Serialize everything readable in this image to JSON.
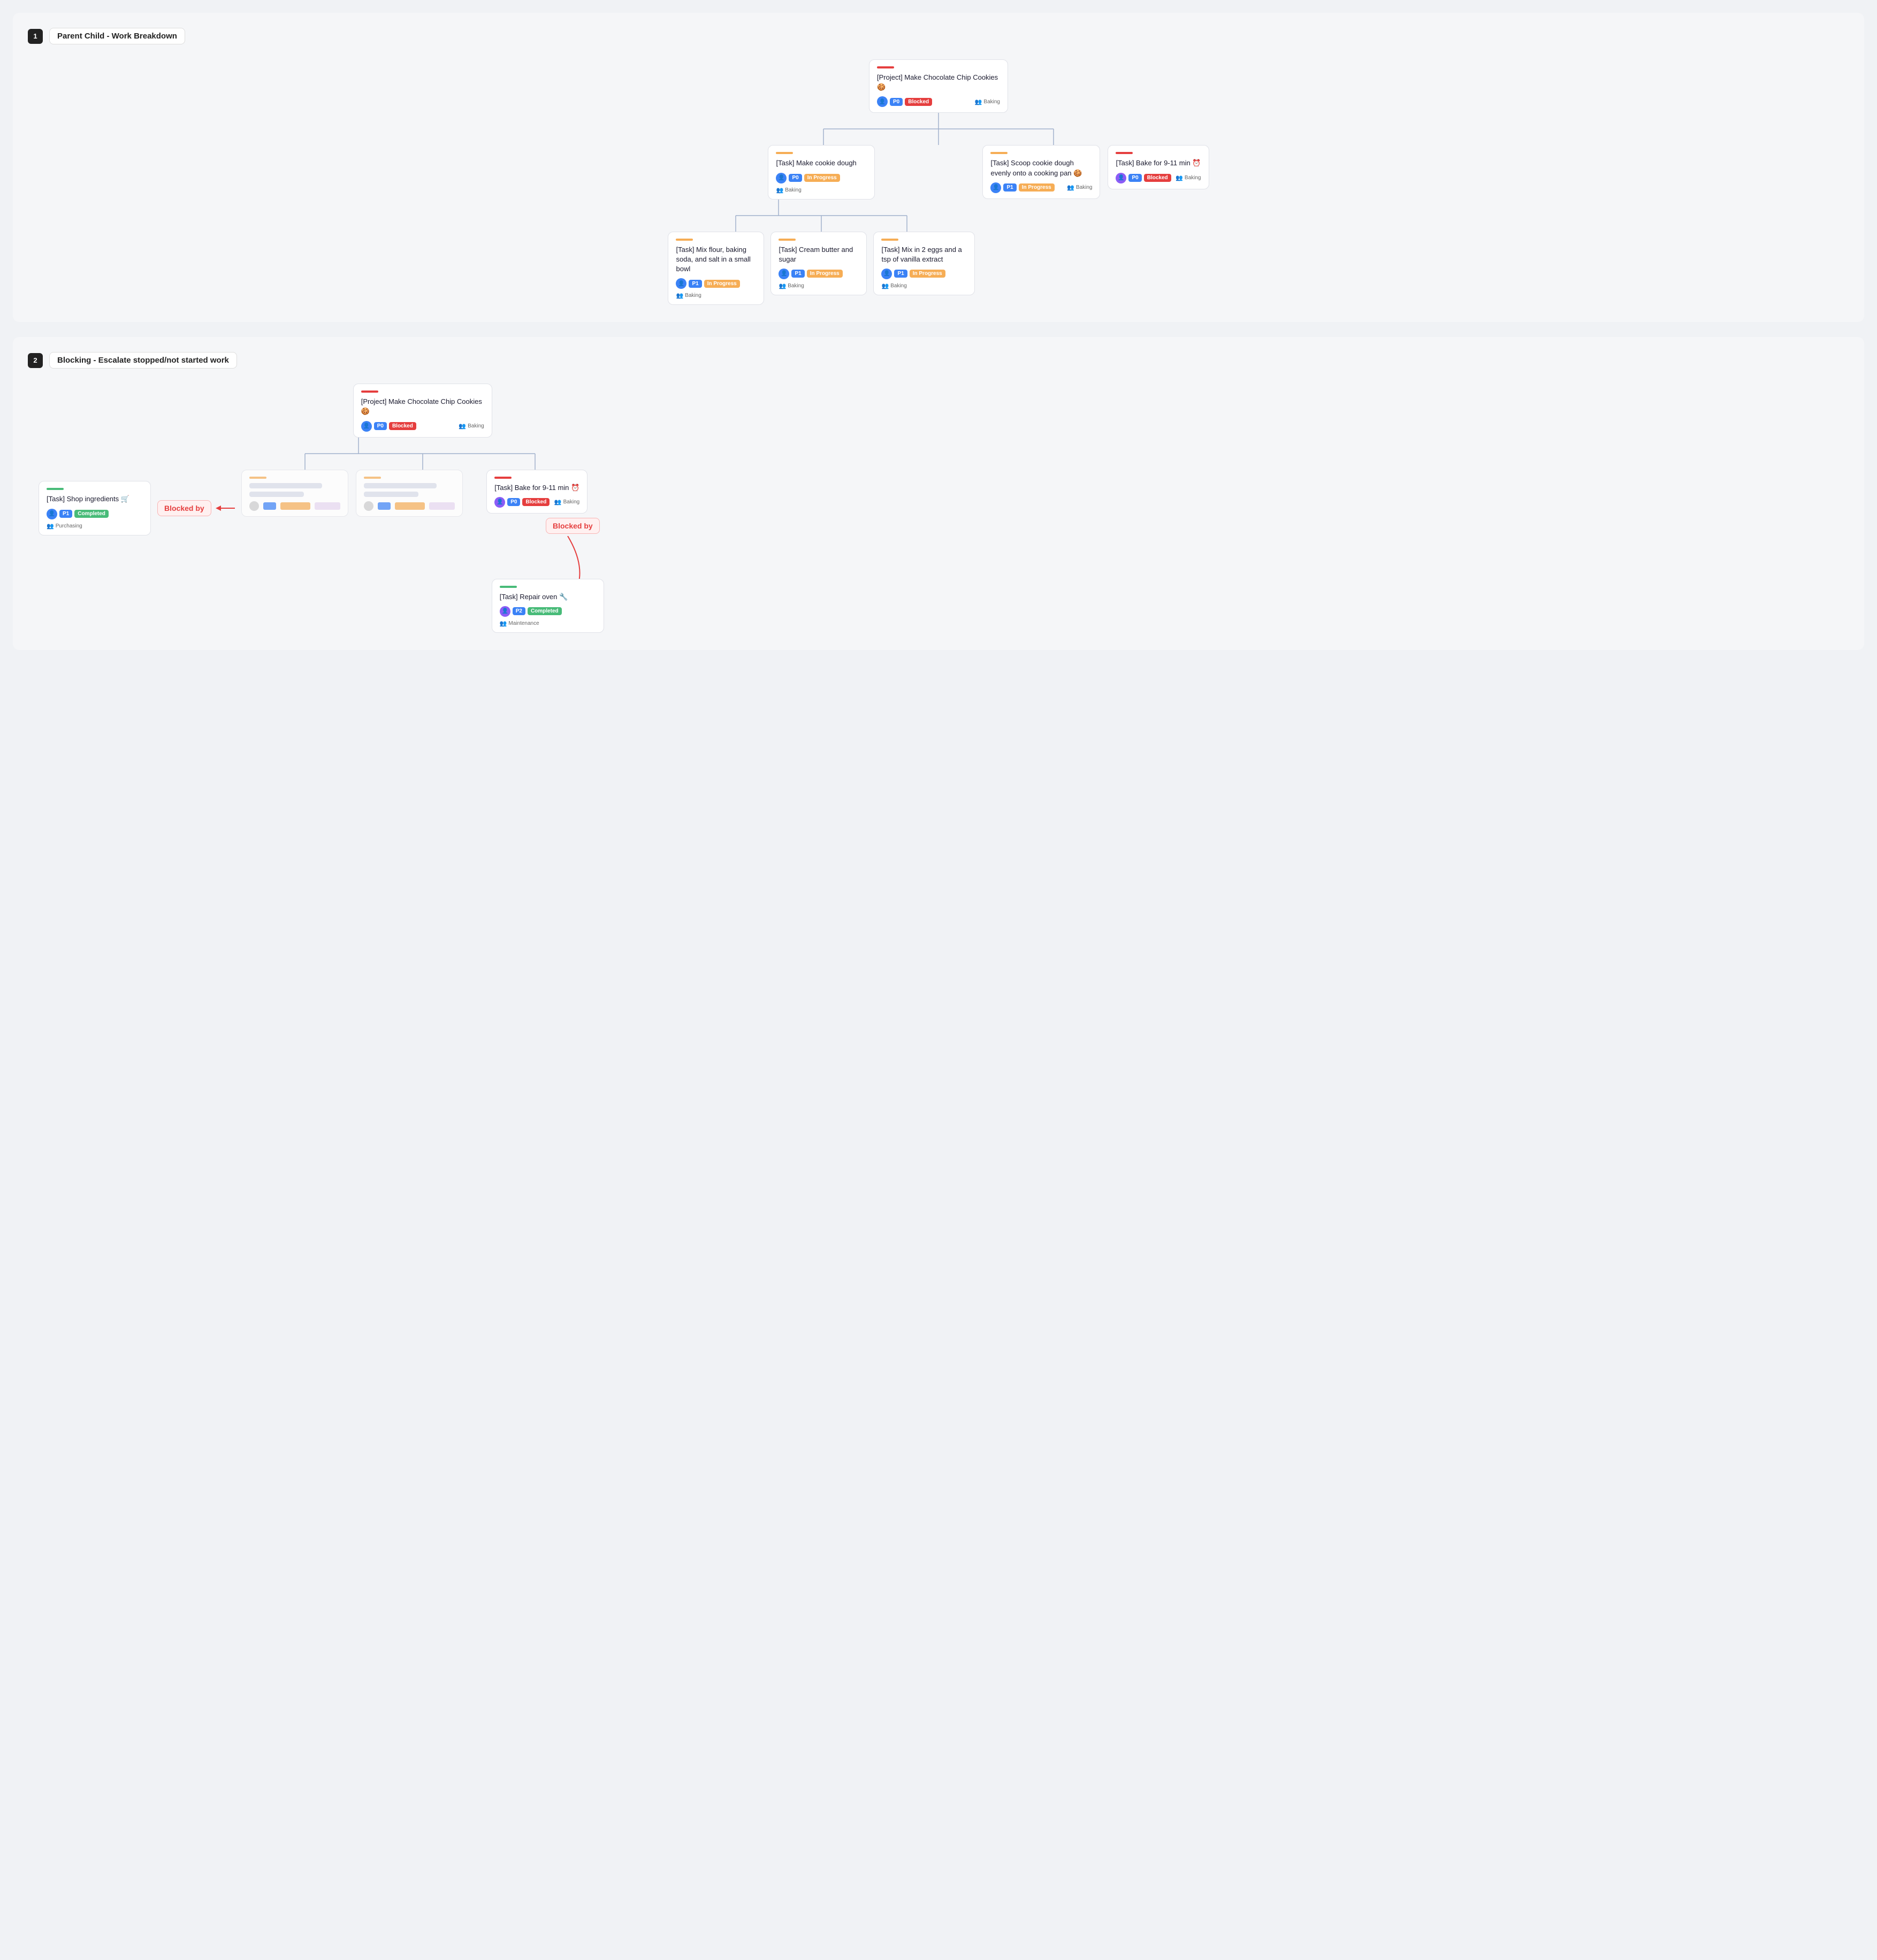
{
  "section1": {
    "number": "1",
    "title": "Parent Child - Work Breakdown",
    "root": {
      "accent": "accent-red",
      "icon": "📄",
      "title": "[Project] Make Chocolate Chip Cookies 🍪",
      "avatar_color": "avatar-blue",
      "priority": "P0",
      "status": "Blocked",
      "status_class": "badge-blocked",
      "team": "Baking"
    },
    "level2": [
      {
        "accent": "accent-orange",
        "title": "[Task] Make cookie dough",
        "avatar_color": "avatar-blue",
        "priority": "P0",
        "status": "In Progress",
        "status_class": "badge-inprogress",
        "team": "Baking"
      },
      {
        "accent": "accent-orange",
        "title": "[Task] Scoop cookie dough evenly onto a cooking pan 🍪",
        "avatar_color": "avatar-blue",
        "priority": "P1",
        "status": "In Progress",
        "status_class": "badge-inprogress",
        "team": "Baking"
      },
      {
        "accent": "accent-red",
        "title": "[Task] Bake for 9-11 min ⏰",
        "avatar_color": "avatar-purple",
        "priority": "P0",
        "status": "Blocked",
        "status_class": "badge-blocked",
        "team": "Baking"
      }
    ],
    "level3": [
      {
        "accent": "accent-orange",
        "title": "[Task] Mix flour, baking soda, and salt in a small bowl",
        "avatar_color": "avatar-blue",
        "priority": "P1",
        "status": "In Progress",
        "status_class": "badge-inprogress",
        "team": "Baking"
      },
      {
        "accent": "accent-orange",
        "title": "[Task] Cream butter and sugar",
        "avatar_color": "avatar-blue",
        "priority": "P1",
        "status": "In Progress",
        "status_class": "badge-inprogress",
        "team": "Baking"
      },
      {
        "accent": "accent-orange",
        "title": "[Task] Mix in 2 eggs and a tsp of vanilla extract",
        "avatar_color": "avatar-blue",
        "priority": "P1",
        "status": "In Progress",
        "status_class": "badge-inprogress",
        "team": "Baking"
      }
    ]
  },
  "section2": {
    "number": "2",
    "title": "Blocking - Escalate stopped/not started work",
    "shop_task": {
      "accent": "accent-green",
      "title": "[Task] Shop ingredients 🛒",
      "avatar_color": "avatar-blue",
      "priority": "P1",
      "status": "Completed",
      "status_class": "badge-completed",
      "team": "Purchasing"
    },
    "blocked_by_label": "Blocked by",
    "project": {
      "accent": "accent-red",
      "icon": "📄",
      "title": "[Project] Make Chocolate Chip Cookies 🍪",
      "avatar_color": "avatar-blue",
      "priority": "P0",
      "status": "Blocked",
      "status_class": "badge-blocked",
      "team": "Baking"
    },
    "bake_task": {
      "accent": "accent-red",
      "title": "[Task] Bake for 9-11 min ⏰",
      "avatar_color": "avatar-purple",
      "priority": "P0",
      "status": "Blocked",
      "status_class": "badge-blocked",
      "team": "Baking"
    },
    "blocked_by_label2": "Blocked by",
    "repair_task": {
      "accent": "accent-green",
      "title": "[Task] Repair oven 🔧",
      "avatar_color": "avatar-purple",
      "priority": "P2",
      "status": "Completed",
      "status_class": "badge-completed",
      "team": "Maintenance"
    }
  }
}
